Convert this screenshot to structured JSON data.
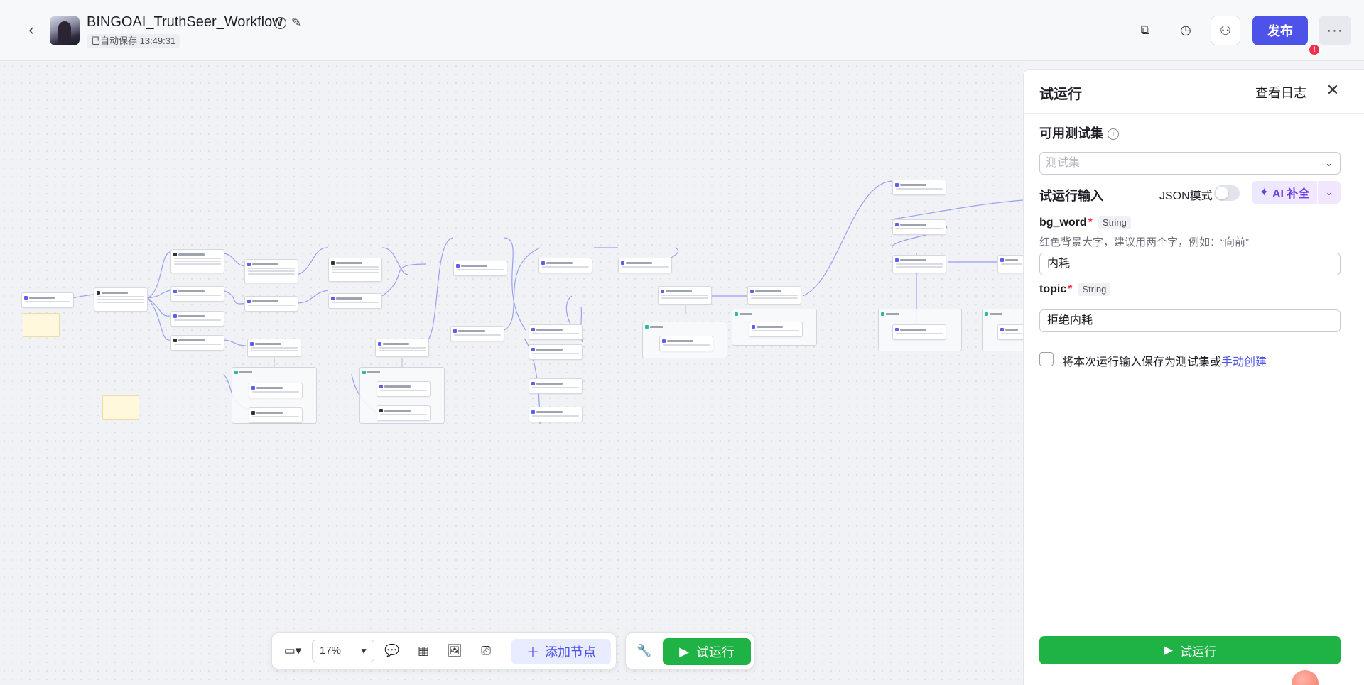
{
  "header": {
    "title": "BINGOAI_TruthSeer_Workflow",
    "autosave": "已自动保存 13:49:31",
    "publish_label": "发布",
    "alert_count": "!"
  },
  "toolbar": {
    "zoom": "17%",
    "add_node_label": "添加节点",
    "run_label": "试运行"
  },
  "panel": {
    "title": "试运行",
    "view_log": "查看日志",
    "testset_label": "可用测试集",
    "testset_placeholder": "测试集",
    "input_label": "试运行输入",
    "json_mode_label": "JSON模式",
    "json_mode_on": false,
    "ai_fill_label": "AI 补全",
    "fields": [
      {
        "name": "bg_word",
        "required": "*",
        "type": "String",
        "description": "红色背景大字，建议用两个字，例如：“向前”",
        "value": "内耗"
      },
      {
        "name": "topic",
        "required": "*",
        "type": "String",
        "description": "",
        "value": "拒绝内耗"
      }
    ],
    "save_checkbox_text": "将本次运行输入保存为测试集或",
    "save_checkbox_link": "手动创建",
    "run_button": "试运行"
  },
  "colors": {
    "brand": "#4d53e8",
    "run_green": "#1fb244",
    "alert_red": "#f0304a"
  },
  "icons": [
    "back-icon",
    "info-icon",
    "edit-icon",
    "copy-icon",
    "history-icon",
    "collaborators-icon",
    "more-icon",
    "minimap-icon",
    "comment-icon",
    "layout-icon",
    "image-icon",
    "screenshot-icon",
    "plus-icon",
    "wrench-icon",
    "play-icon",
    "close-icon",
    "chevron-down-icon",
    "sparkle-icon"
  ]
}
